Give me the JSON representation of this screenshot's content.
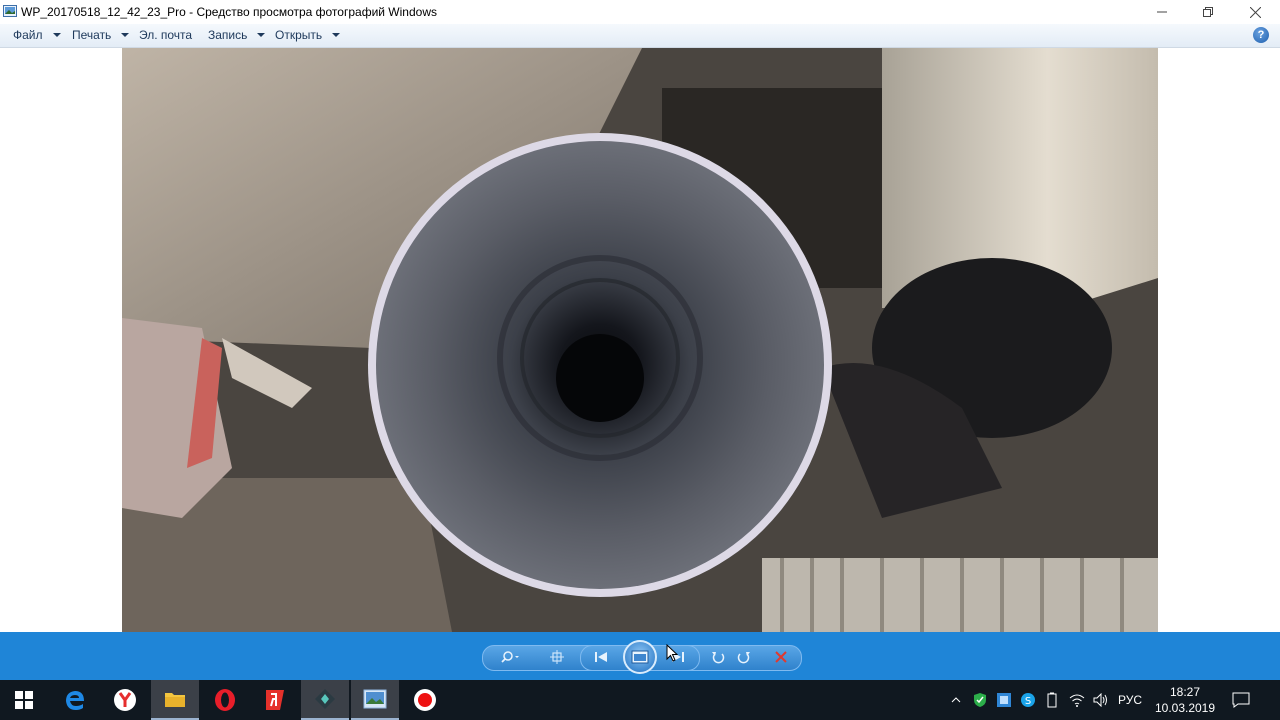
{
  "window": {
    "title": "WP_20170518_12_42_23_Pro - Средство просмотра фотографий Windows",
    "minimize_icon": "minimize-icon",
    "restore_icon": "restore-icon",
    "close_icon": "close-icon"
  },
  "menu": {
    "items": [
      {
        "label": "Файл",
        "has_dropdown": true
      },
      {
        "label": "Печать",
        "has_dropdown": true
      },
      {
        "label": "Эл. почта",
        "has_dropdown": false
      },
      {
        "label": "Запись",
        "has_dropdown": true
      },
      {
        "label": "Открыть",
        "has_dropdown": true
      }
    ],
    "help_label": "?"
  },
  "photo": {
    "subject_icon": "photo-image"
  },
  "controls": {
    "buttons": [
      "zoom-icon",
      "actual-size-icon",
      "previous-icon",
      "slideshow-icon",
      "next-icon",
      "rotate-left-icon",
      "rotate-right-icon",
      "delete-icon"
    ],
    "accent": "#1f85d7"
  },
  "taskbar": {
    "apps": [
      "windows-start-icon",
      "edge-icon",
      "yandex-browser-icon",
      "file-explorer-icon",
      "opera-icon",
      "yandex-icon",
      "filmora-icon",
      "photo-viewer-icon",
      "record-icon"
    ],
    "tray": {
      "language": "РУС",
      "time": "18:27",
      "date": "10.03.2019"
    }
  }
}
